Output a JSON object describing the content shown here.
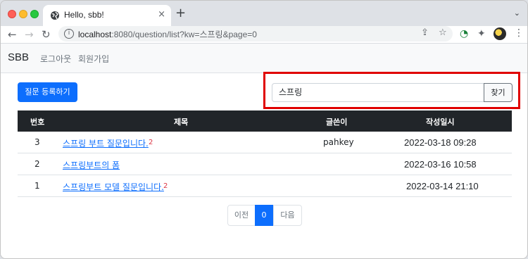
{
  "browser": {
    "tab_title": "Hello, sbb!",
    "tab_close": "×",
    "new_tab": "+",
    "tab_menu": "⌄",
    "url_host": "localhost",
    "url_rest": ":8080/question/list?kw=스프링&page=0",
    "info_icon": "i",
    "icons": [
      "back-arrow-icon",
      "forward-arrow-icon",
      "reload-icon",
      "share-icon",
      "star-icon",
      "extension-check-icon",
      "puzzle-icon",
      "avatar",
      "kebab-menu-icon"
    ]
  },
  "navbar": {
    "brand": "SBB",
    "links": [
      "로그아웃",
      "회원가입"
    ]
  },
  "actions": {
    "create_question": "질문 등록하기",
    "search_value": "스프링",
    "search_button": "찾기"
  },
  "table": {
    "headers": [
      "번호",
      "제목",
      "글쓴이",
      "작성일시"
    ],
    "rows": [
      {
        "num": "3",
        "title": "스프링 부트 질문입니다.",
        "answers": "2",
        "author": "pahkey",
        "date": "2022-03-18 09:28"
      },
      {
        "num": "2",
        "title": "스프링부트의 폼",
        "answers": "",
        "author": "",
        "date": "2022-03-16 10:58"
      },
      {
        "num": "1",
        "title": "스프링부트 모델 질문입니다.",
        "answers": "2",
        "author": "",
        "date": "2022-03-14 21:10"
      }
    ]
  },
  "pagination": {
    "prev": "이전",
    "current": "0",
    "next": "다음"
  },
  "colors": {
    "primary": "#0d6efd",
    "danger": "#dc3545",
    "table_header": "#212529",
    "highlight_box": "#e00000"
  }
}
